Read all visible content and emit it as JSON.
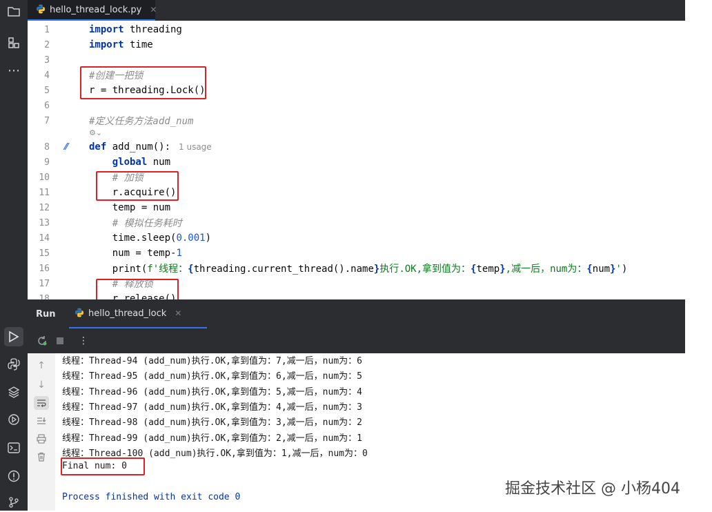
{
  "editor": {
    "tab_label": "hello_thread_lock.py",
    "lines": [
      {
        "n": "1",
        "html": "<span class='kw'>import</span> threading"
      },
      {
        "n": "2",
        "html": "<span class='kw'>import</span> time"
      },
      {
        "n": "3",
        "html": ""
      },
      {
        "n": "4",
        "html": "<span class='cm'>#创建一把锁</span>"
      },
      {
        "n": "5",
        "html": "r = threading.Lock()"
      },
      {
        "n": "6",
        "html": ""
      },
      {
        "n": "7",
        "html": "<span class='cm'>#定义任务方法add_num</span>"
      },
      {
        "n": "8",
        "html": "<span class='kw'>def</span> add_num():<span class='usage'>1 usage</span>"
      },
      {
        "n": "9",
        "html": "    <span class='kw'>global</span> num"
      },
      {
        "n": "10",
        "html": "    <span class='cm'># 加锁</span>"
      },
      {
        "n": "11",
        "html": "    r.acquire()"
      },
      {
        "n": "12",
        "html": "    temp = num"
      },
      {
        "n": "13",
        "html": "    <span class='cm'># 模拟任务耗时</span>"
      },
      {
        "n": "14",
        "html": "    time.sleep(<span class='num'>0.001</span>)"
      },
      {
        "n": "15",
        "html": "    num = temp-<span class='num'>1</span>"
      },
      {
        "n": "16",
        "html": "    print(<span class='str'>f'线程：</span><span class='kw'>{</span>threading.current_thread().name<span class='kw'>}</span><span class='str'>执行.OK,拿到值为：</span><span class='kw'>{</span>temp<span class='kw'>}</span><span class='str'>,减一后，num为：</span><span class='kw'>{</span>num<span class='kw'>}</span><span class='str'>'</span>)"
      },
      {
        "n": "17",
        "html": "    <span class='cm'># 释放锁</span>"
      },
      {
        "n": "18",
        "html": "    r.release()"
      }
    ]
  },
  "run": {
    "title": "Run",
    "tab_label": "hello_thread_lock",
    "output": [
      "线程：Thread-94 (add_num)执行.OK,拿到值为：7,减一后，num为：6",
      "线程：Thread-95 (add_num)执行.OK,拿到值为：6,减一后，num为：5",
      "线程：Thread-96 (add_num)执行.OK,拿到值为：5,减一后，num为：4",
      "线程：Thread-97 (add_num)执行.OK,拿到值为：4,减一后，num为：3",
      "线程：Thread-98 (add_num)执行.OK,拿到值为：3,减一后，num为：2",
      "线程：Thread-99 (add_num)执行.OK,拿到值为：2,减一后，num为：1",
      "线程：Thread-100 (add_num)执行.OK,拿到值为：1,减一后，num为：0",
      "Final num: 0",
      "",
      "Process finished with exit code 0"
    ]
  },
  "watermark": "掘金技术社区 @ 小杨404",
  "colors": {
    "accent": "#3574f0",
    "highlight_box": "#e02020",
    "keyword": "#0033b3",
    "comment": "#8c8c8c",
    "string": "#067d17",
    "number": "#1750eb"
  }
}
